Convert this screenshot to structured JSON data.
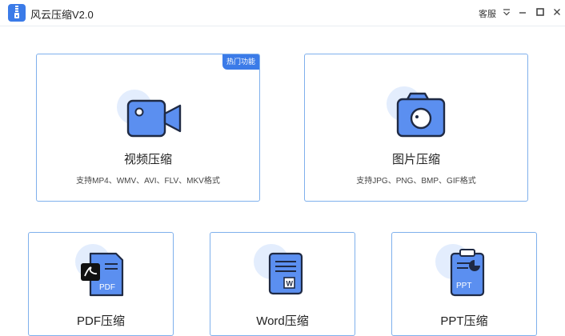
{
  "window": {
    "title": "风云压缩V2.0",
    "service_label": "客服"
  },
  "cards": {
    "video": {
      "title": "视频压缩",
      "desc": "支持MP4、WMV、AVI、FLV、MKV格式",
      "badge": "热门功能",
      "icon": "video-camera-icon"
    },
    "image": {
      "title": "图片压缩",
      "desc": "支持JPG、PNG、BMP、GIF格式",
      "icon": "camera-icon"
    },
    "pdf": {
      "title": "PDF压缩",
      "icon_text": "PDF",
      "icon": "pdf-file-icon"
    },
    "word": {
      "title": "Word压缩",
      "icon_text": "W",
      "icon": "word-file-icon"
    },
    "ppt": {
      "title": "PPT压缩",
      "icon_text": "PPT",
      "icon": "ppt-file-icon"
    }
  },
  "colors": {
    "accent": "#3b7be8",
    "icon_fill": "#5b8ff0",
    "icon_bg": "#e3edfd",
    "card_border": "#7fb0ec"
  }
}
